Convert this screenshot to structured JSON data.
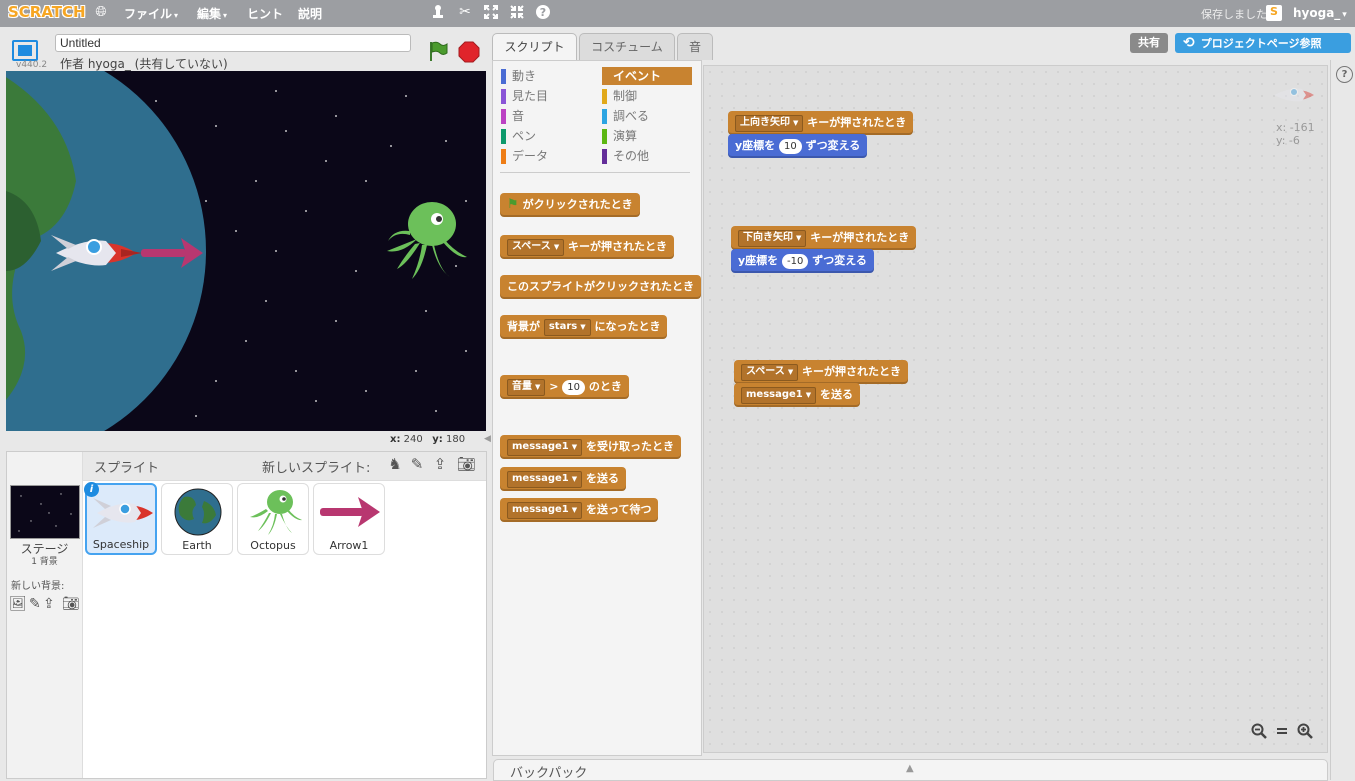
{
  "app": {
    "logo": "SCRATCH",
    "menus": [
      {
        "label": "ファイル",
        "caret": "▾"
      },
      {
        "label": "編集",
        "caret": "▾"
      },
      {
        "label": "ヒント",
        "caret": ""
      },
      {
        "label": "説明",
        "caret": ""
      }
    ],
    "saved_status": "保存しました",
    "username": "hyoga_",
    "username_caret": "▾"
  },
  "stage": {
    "version": "v440.2",
    "project_title": "Untitled",
    "author": "作者 hyoga_ (共有していない)",
    "x_label": "x:",
    "x_value": "240",
    "y_label": "y:",
    "y_value": "180"
  },
  "sprites_pane": {
    "title": "スプライト",
    "new_sprite_label": "新しいスプライト:",
    "stage_name": "ステージ",
    "stage_backdrops": "1 背景",
    "new_backdrop_label": "新しい背景:",
    "info_badge": "i",
    "sprites": [
      {
        "name": "Spaceship",
        "selected": true
      },
      {
        "name": "Earth",
        "selected": false
      },
      {
        "name": "Octopus",
        "selected": false
      },
      {
        "name": "Arrow1",
        "selected": false
      }
    ]
  },
  "tabs": [
    {
      "label": "スクリプト",
      "active": true
    },
    {
      "label": "コスチューム",
      "active": false
    },
    {
      "label": "音",
      "active": false
    }
  ],
  "buttons": {
    "share": "共有",
    "project_page": "プロジェクトページ参照",
    "help": "?"
  },
  "categories": {
    "left": [
      {
        "label": "動き",
        "color": "#4a6cd4"
      },
      {
        "label": "見た目",
        "color": "#8a55d7"
      },
      {
        "label": "音",
        "color": "#bb42c3"
      },
      {
        "label": "ペン",
        "color": "#0e9a6c"
      },
      {
        "label": "データ",
        "color": "#ee7d16"
      }
    ],
    "right": [
      {
        "label": "イベント",
        "color": "#c88330",
        "active": true
      },
      {
        "label": "制御",
        "color": "#e1a91a"
      },
      {
        "label": "調べる",
        "color": "#2ca5e2"
      },
      {
        "label": "演算",
        "color": "#5cb712"
      },
      {
        "label": "その他",
        "color": "#632d99"
      }
    ]
  },
  "palette_blocks": {
    "flag_clicked": "がクリックされたとき",
    "key_pressed_dd": "スペース",
    "key_pressed": "キーが押されたとき",
    "sprite_clicked": "このスプライトがクリックされたとき",
    "backdrop_prefix": "背景が",
    "backdrop_dd": "stars",
    "backdrop_suffix": "になったとき",
    "sensor_dd": "音量",
    "gt": ">",
    "sensor_value": "10",
    "sensor_suffix": "のとき",
    "msg_dd": "message1",
    "receive": "を受け取ったとき",
    "broadcast": "を送る",
    "broadcast_wait": "を送って待つ"
  },
  "scripts": [
    {
      "hat_dd": "上向き矢印",
      "hat_text": "キーが押されたとき",
      "cmd_prefix": "y座標を",
      "cmd_value": "10",
      "cmd_suffix": "ずつ変える"
    },
    {
      "hat_dd": "下向き矢印",
      "hat_text": "キーが押されたとき",
      "cmd_prefix": "y座標を",
      "cmd_value": "-10",
      "cmd_suffix": "ずつ変える"
    },
    {
      "hat_dd": "スペース",
      "hat_text": "キーが押されたとき",
      "cmd_dd": "message1",
      "cmd_suffix": "を送る"
    }
  ],
  "script_area": {
    "sprite_x": "x: -161",
    "sprite_y": "y: -6"
  },
  "backpack": {
    "label": "バックパック",
    "arrow": "▲"
  },
  "colors": {
    "events": "#c88330",
    "motion": "#4a6cd4",
    "accent": "#3a9ee0",
    "menubar": "#9c9ea2"
  }
}
